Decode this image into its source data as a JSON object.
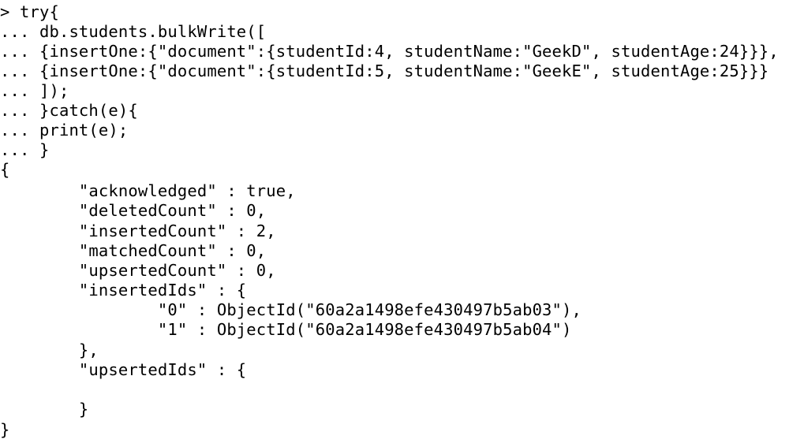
{
  "terminal": {
    "lines": [
      "> try{",
      "... db.students.bulkWrite([",
      "... {insertOne:{\"document\":{studentId:4, studentName:\"GeekD\", studentAge:24}}},",
      "... {insertOne:{\"document\":{studentId:5, studentName:\"GeekE\", studentAge:25}}}",
      "... ]);",
      "... }catch(e){",
      "... print(e);",
      "... }",
      "{",
      "        \"acknowledged\" : true,",
      "        \"deletedCount\" : 0,",
      "        \"insertedCount\" : 2,",
      "        \"matchedCount\" : 0,",
      "        \"upsertedCount\" : 0,",
      "        \"insertedIds\" : {",
      "                \"0\" : ObjectId(\"60a2a1498efe430497b5ab03\"),",
      "                \"1\" : ObjectId(\"60a2a1498efe430497b5ab04\")",
      "        },",
      "        \"upsertedIds\" : {",
      "",
      "        }",
      "}"
    ]
  }
}
